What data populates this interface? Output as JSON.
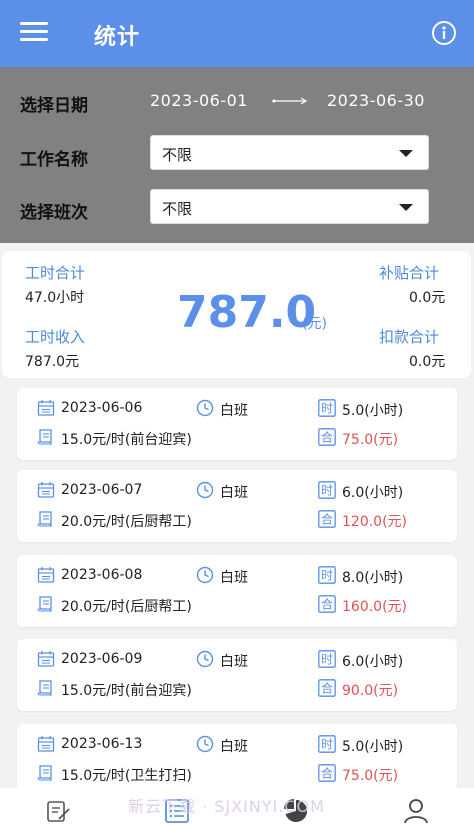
{
  "header": {
    "title": "统计"
  },
  "filter": {
    "date_label": "选择日期",
    "date_start": "2023-06-01",
    "date_end": "2023-06-30",
    "job_label": "工作名称",
    "job_value": "不限",
    "shift_label": "选择班次",
    "shift_value": "不限"
  },
  "summary": {
    "hours_label": "工时合计",
    "hours_value": "47.0小时",
    "income_label": "工时收入",
    "income_value": "787.0元",
    "total_value": "787.0",
    "total_unit": "(元)",
    "subsidy_label": "补贴合计",
    "subsidy_value": "0.0元",
    "deduction_label": "扣款合计",
    "deduction_value": "0.0元"
  },
  "records": [
    {
      "date": "2023-06-06",
      "shift": "白班",
      "hours": "5.0(小时)",
      "rate": "15.0元/时(前台迎宾)",
      "total": "75.0(元)"
    },
    {
      "date": "2023-06-07",
      "shift": "白班",
      "hours": "6.0(小时)",
      "rate": "20.0元/时(后厨帮工)",
      "total": "120.0(元)"
    },
    {
      "date": "2023-06-08",
      "shift": "白班",
      "hours": "8.0(小时)",
      "rate": "20.0元/时(后厨帮工)",
      "total": "160.0(元)"
    },
    {
      "date": "2023-06-09",
      "shift": "白班",
      "hours": "6.0(小时)",
      "rate": "15.0元/时(前台迎宾)",
      "total": "90.0(元)"
    },
    {
      "date": "2023-06-13",
      "shift": "白班",
      "hours": "5.0(小时)",
      "rate": "15.0元/时(卫生打扫)",
      "total": "75.0(元)"
    }
  ],
  "icons": {
    "hours_glyph": "时",
    "total_glyph": "合"
  },
  "watermark": "新云下载 · SJXINYI.COM",
  "colors": {
    "primary": "#5b8fe8",
    "accent_red": "#e05353",
    "filter_bg": "#7f8183"
  }
}
